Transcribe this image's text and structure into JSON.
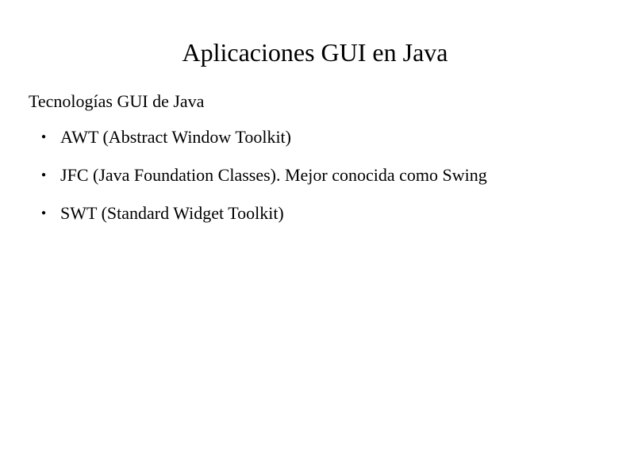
{
  "slide": {
    "title": "Aplicaciones GUI en Java",
    "subtitle": "Tecnologías GUI de Java",
    "bullets": [
      "AWT (Abstract Window Toolkit)",
      "JFC (Java Foundation Classes). Mejor conocida como Swing",
      "SWT (Standard Widget Toolkit)"
    ]
  }
}
